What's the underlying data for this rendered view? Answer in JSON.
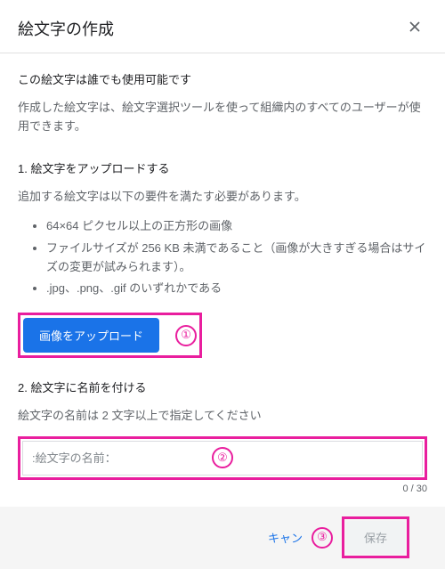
{
  "header": {
    "title": "絵文字の作成"
  },
  "intro": {
    "bold": "この絵文字は誰でも使用可能です",
    "desc": "作成した絵文字は、絵文字選択ツールを使って組織内のすべてのユーザーが使用できます。"
  },
  "section1": {
    "title": "1. 絵文字をアップロードする",
    "desc": "追加する絵文字は以下の要件を満たす必要があります。",
    "req1": "64×64 ピクセル以上の正方形の画像",
    "req2": "ファイルサイズが 256 KB 未満であること（画像が大きすぎる場合はサイズの変更が試みられます）。",
    "req3": ".jpg、.png、.gif のいずれかである",
    "upload_label": "画像をアップロード"
  },
  "section2": {
    "title": "2. 絵文字に名前を付ける",
    "desc": "絵文字の名前は 2 文字以上で指定してください",
    "placeholder": ":絵文字の名前：",
    "counter": "0 / 30"
  },
  "footer": {
    "cancel": "キャン",
    "save": "保存"
  },
  "annotations": {
    "b1": "①",
    "b2": "②",
    "b3": "③"
  }
}
